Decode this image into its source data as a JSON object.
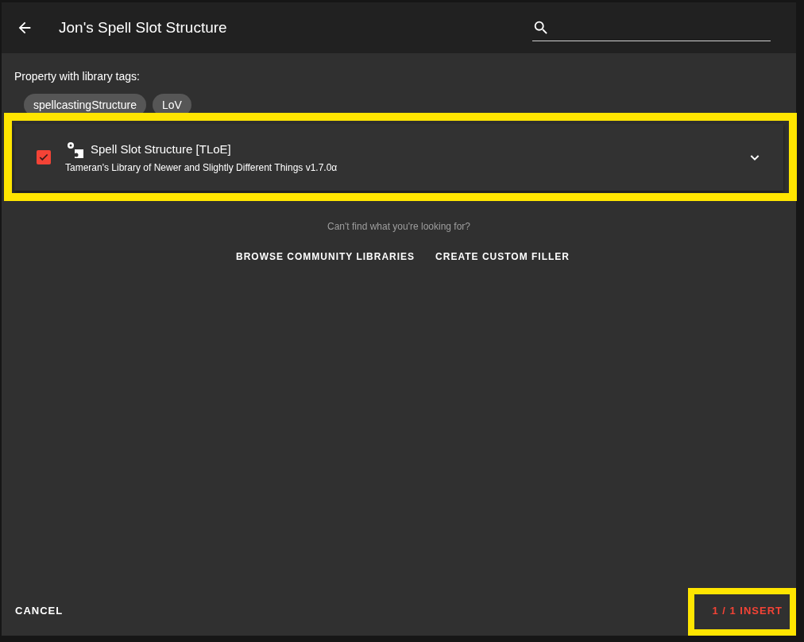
{
  "dialog": {
    "title": "Jon's Spell Slot Structure",
    "tags_label": "Property with library tags:",
    "tags": [
      "spellcastingStructure",
      "LoV"
    ],
    "items": [
      {
        "title": "Spell Slot Structure [TLoE]",
        "library": "Tameran's Library of Newer and Slightly Different Things v1.7.0α",
        "checked": true,
        "expanded": false,
        "highlighted": true
      }
    ],
    "hint": "Can't find what you're looking for?",
    "links": [
      "BROWSE COMMUNITY LIBRARIES",
      "CREATE CUSTOM FILLER"
    ],
    "cancel": "CANCEL",
    "insert": {
      "label": "1 / 1 INSERT",
      "highlighted": true
    }
  }
}
